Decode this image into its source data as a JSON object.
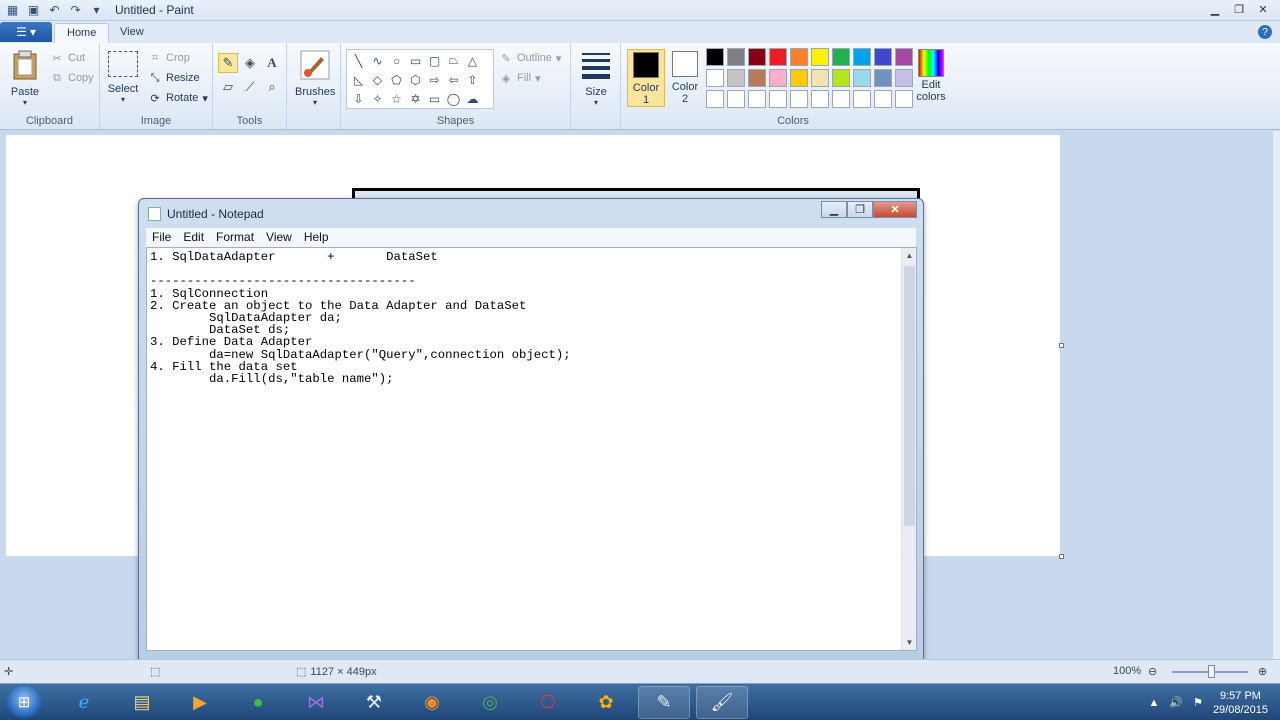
{
  "paint": {
    "title": "Untitled - Paint",
    "tabs": [
      "Home",
      "View"
    ],
    "clipboard": {
      "paste": "Paste",
      "cut": "Cut",
      "copy": "Copy",
      "label": "Clipboard"
    },
    "image": {
      "select": "Select",
      "crop": "Crop",
      "resize": "Resize",
      "rotate": "Rotate",
      "label": "Image"
    },
    "tools": {
      "label": "Tools",
      "brushes": "Brushes"
    },
    "shapes": {
      "outline": "Outline",
      "fill": "Fill",
      "label": "Shapes"
    },
    "size": "Size",
    "color1": {
      "label1": "Color",
      "label2": "1",
      "value": "#000000"
    },
    "color2": {
      "label1": "Color",
      "label2": "2",
      "value": "#ffffff"
    },
    "colors_label": "Colors",
    "edit_colors": {
      "line1": "Edit",
      "line2": "colors"
    },
    "palette_row1": [
      "#000000",
      "#7f7f7f",
      "#880015",
      "#ed1c24",
      "#ff7f27",
      "#fff200",
      "#22b14c",
      "#00a2e8",
      "#3f48cc",
      "#a349a4"
    ],
    "palette_row2": [
      "#ffffff",
      "#c3c3c3",
      "#b97a57",
      "#ffaec9",
      "#ffc90e",
      "#efe4b0",
      "#b5e61d",
      "#99d9ea",
      "#7092be",
      "#c8bfe7"
    ],
    "statusbar": {
      "size": "1127 × 449px",
      "zoom": "100%"
    }
  },
  "notepad": {
    "title": "Untitled - Notepad",
    "menu": [
      "File",
      "Edit",
      "Format",
      "View",
      "Help"
    ],
    "text": "1. SqlDataAdapter       +       DataSet\n\n------------------------------------\n1. SqlConnection\n2. Create an object to the Data Adapter and DataSet\n        SqlDataAdapter da;\n        DataSet ds;\n3. Define Data Adapter\n        da=new SqlDataAdapter(\"Query\",connection object);\n4. Fill the data set\n        da.Fill(ds,\"table name\");"
  },
  "taskbar": {
    "time": "9:57 PM",
    "date": "29/08/2015"
  }
}
